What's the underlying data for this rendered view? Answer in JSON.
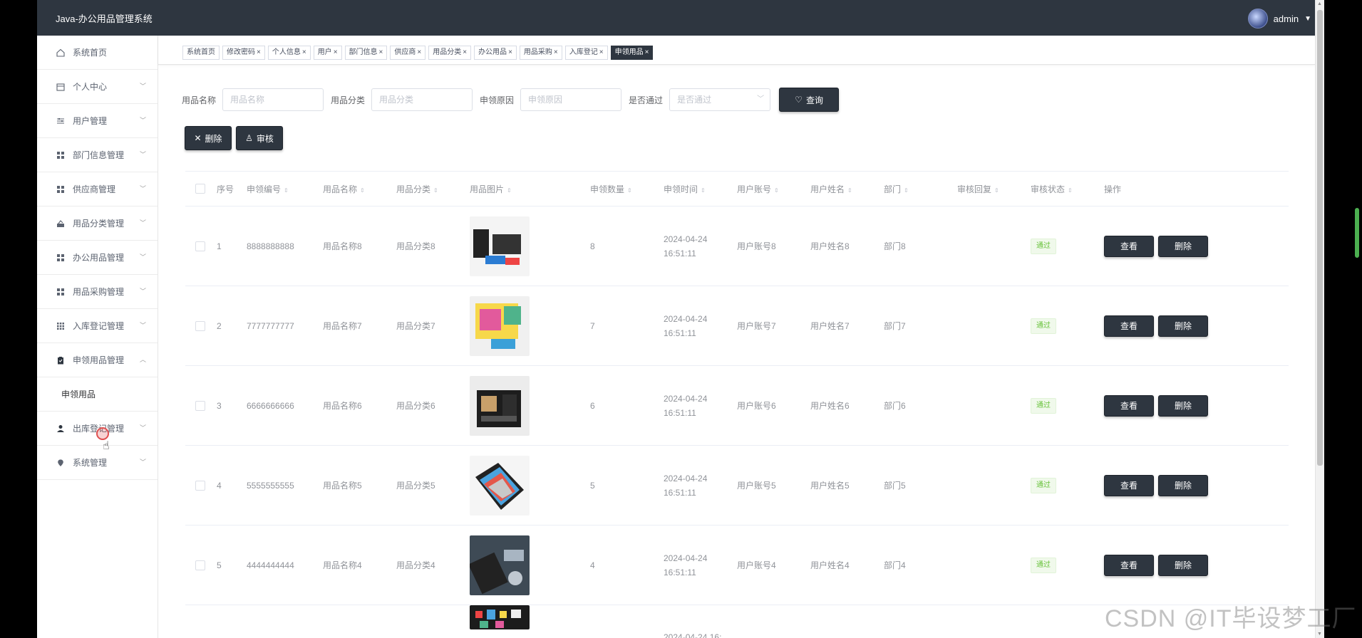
{
  "app": {
    "title": "Java-办公用品管理系统",
    "user": "admin"
  },
  "sidebar": {
    "items": [
      {
        "label": "系统首页",
        "icon": "home-icon"
      },
      {
        "label": "个人中心",
        "icon": "calendar-icon"
      },
      {
        "label": "用户管理",
        "icon": "sliders-icon"
      },
      {
        "label": "部门信息管理",
        "icon": "grid-icon"
      },
      {
        "label": "供应商管理",
        "icon": "grid-icon"
      },
      {
        "label": "用品分类管理",
        "icon": "chart-icon"
      },
      {
        "label": "办公用品管理",
        "icon": "grid-icon"
      },
      {
        "label": "用品采购管理",
        "icon": "grid-icon"
      },
      {
        "label": "入库登记管理",
        "icon": "apps-icon"
      },
      {
        "label": "申领用品管理",
        "icon": "clipboard-icon"
      }
    ],
    "submenu_label": "申领用品",
    "items_after": [
      {
        "label": "出库登记管理",
        "icon": "user-icon"
      },
      {
        "label": "系统管理",
        "icon": "location-icon"
      }
    ]
  },
  "tags": [
    "系统首页",
    "修改密码",
    "个人信息",
    "用户",
    "部门信息",
    "供应商",
    "用品分类",
    "办公用品",
    "用品采购",
    "入库登记",
    "申领用品"
  ],
  "search": {
    "name_label": "用品名称",
    "name_placeholder": "用品名称",
    "category_label": "用品分类",
    "category_placeholder": "用品分类",
    "reason_label": "申领原因",
    "reason_placeholder": "申领原因",
    "pass_label": "是否通过",
    "pass_placeholder": "是否通过",
    "query_button": "查询"
  },
  "actions": {
    "delete": "删除",
    "audit": "审核"
  },
  "table": {
    "headers": [
      "序号",
      "申领编号",
      "用品名称",
      "用品分类",
      "用品图片",
      "申领数量",
      "申领时间",
      "用户账号",
      "用户姓名",
      "部门",
      "审核回复",
      "审核状态",
      "操作"
    ],
    "view_button": "查看",
    "delete_button": "删除",
    "rows": [
      {
        "idx": "1",
        "code": "8888888888",
        "name": "用品名称8",
        "cat": "用品分类8",
        "qty": "8",
        "time": "2024-04-24 16:51:11",
        "account": "用户账号8",
        "user": "用户姓名8",
        "dept": "部门8",
        "reply": "",
        "status": "通过"
      },
      {
        "idx": "2",
        "code": "7777777777",
        "name": "用品名称7",
        "cat": "用品分类7",
        "qty": "7",
        "time": "2024-04-24 16:51:11",
        "account": "用户账号7",
        "user": "用户姓名7",
        "dept": "部门7",
        "reply": "",
        "status": "通过"
      },
      {
        "idx": "3",
        "code": "6666666666",
        "name": "用品名称6",
        "cat": "用品分类6",
        "qty": "6",
        "time": "2024-04-24 16:51:11",
        "account": "用户账号6",
        "user": "用户姓名6",
        "dept": "部门6",
        "reply": "",
        "status": "通过"
      },
      {
        "idx": "4",
        "code": "5555555555",
        "name": "用品名称5",
        "cat": "用品分类5",
        "qty": "5",
        "time": "2024-04-24 16:51:11",
        "account": "用户账号5",
        "user": "用户姓名5",
        "dept": "部门5",
        "reply": "",
        "status": "通过"
      },
      {
        "idx": "5",
        "code": "4444444444",
        "name": "用品名称4",
        "cat": "用品分类4",
        "qty": "4",
        "time": "2024-04-24 16:51:11",
        "account": "用户账号4",
        "user": "用户姓名4",
        "dept": "部门4",
        "reply": "",
        "status": "通过"
      }
    ],
    "partial_row_time": "2024-04-24 16:"
  },
  "watermark": "CSDN @IT毕设梦工厂"
}
